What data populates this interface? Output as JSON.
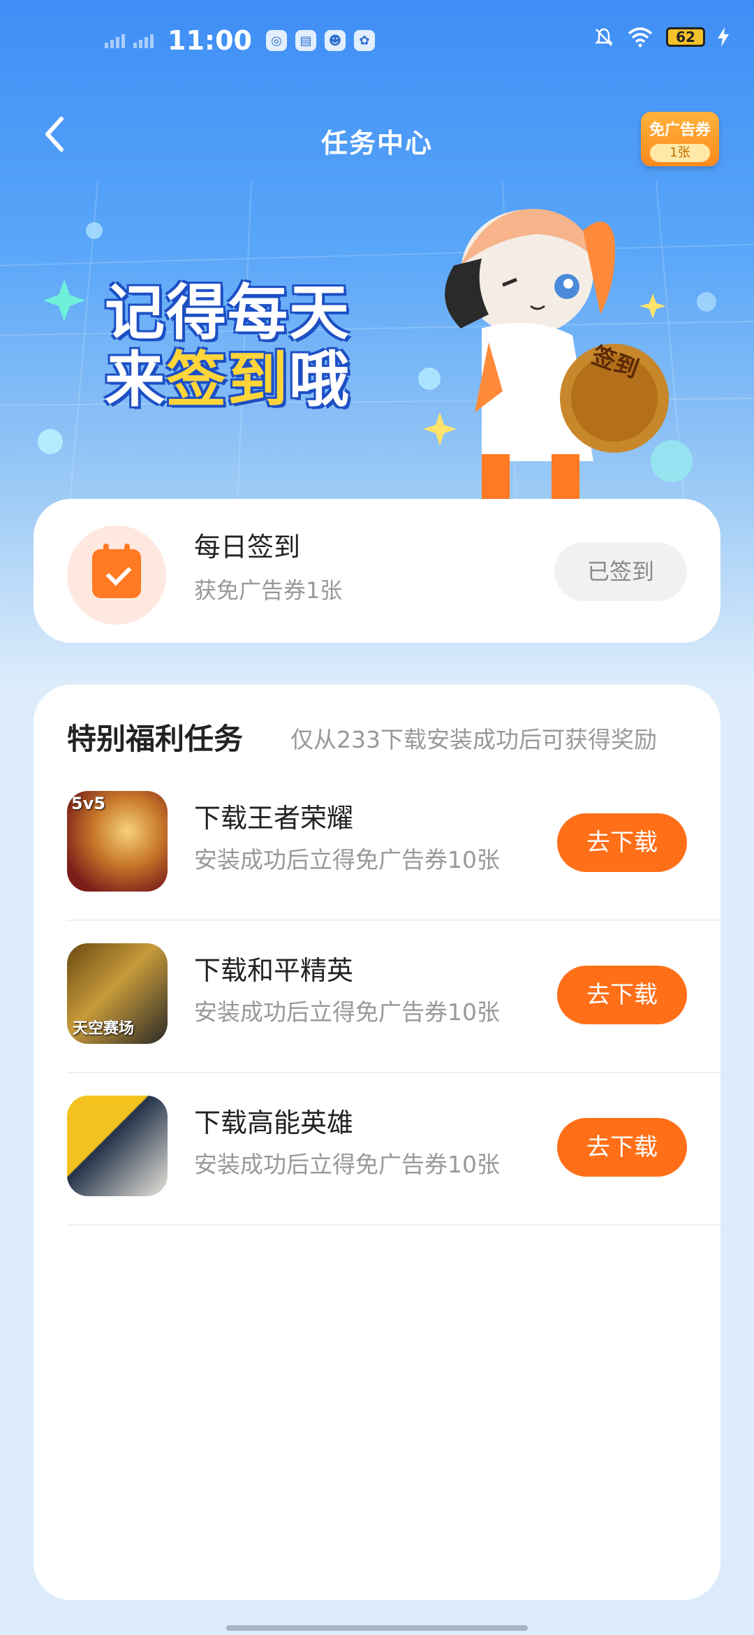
{
  "status_bar": {
    "time": "11:00",
    "battery": "62",
    "app_icons": [
      "map-icon",
      "book-icon",
      "mascot-icon",
      "paw-icon"
    ]
  },
  "header": {
    "title": "任务中心",
    "ad_ticket_label": "免广告券",
    "ad_ticket_count": "1张"
  },
  "banner": {
    "line1": "记得每天",
    "line2_prefix": "来",
    "line2_highlight": "签到",
    "line2_suffix": "哦",
    "coin_text": "签到"
  },
  "daily_checkin": {
    "title": "每日签到",
    "subtitle": "获免广告券1张",
    "button": "已签到"
  },
  "special_tasks": {
    "title": "特别福利任务",
    "note": "仅从233下载安装成功后可获得奖励",
    "items": [
      {
        "name": "下载王者荣耀",
        "desc": "安装成功后立得免广告券10张",
        "button": "去下载",
        "icon_label": "5v5"
      },
      {
        "name": "下载和平精英",
        "desc": "安装成功后立得免广告券10张",
        "button": "去下载",
        "icon_label": "天空赛场"
      },
      {
        "name": "下载高能英雄",
        "desc": "安装成功后立得免广告券10张",
        "button": "去下载",
        "icon_label": ""
      }
    ]
  },
  "colors": {
    "accent": "#ff6f18",
    "header_blue": "#3f8ef6",
    "badge": "#ff9a2a"
  }
}
